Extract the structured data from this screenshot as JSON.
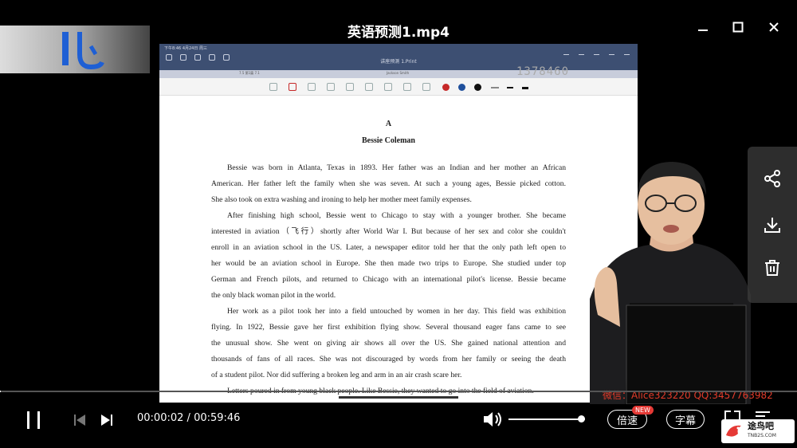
{
  "window": {
    "title": "英语预测1.mp4"
  },
  "screen_share": {
    "status_bar": "下午8:46  4月24日 周三",
    "doc_app_title": "讲座预测 1.Print",
    "tabs": [
      "7.5 第1篇 7.1",
      "Jackson Smith"
    ],
    "watermark_number": "1378460",
    "pen_colors": [
      "#c62828",
      "#1e4f9c",
      "#111111"
    ],
    "document": {
      "section": "A",
      "title": "Bessie Coleman",
      "paragraphs": [
        [
          "Bessie was born in Atlanta, Texas in 1893. Her father was an Indian and her mother an African",
          "American. Her father left the family when she was seven. At such a young ages, Bessie picked cotton.",
          "She also took on extra washing and ironing to help her mother meet family expenses."
        ],
        [
          "After finishing high school, Bessie went to Chicago to stay with a younger brother. She became",
          "interested in aviation（飞行）shortly after World War I. But because of her sex and color she couldn't",
          "enroll in an aviation school in the US. Later, a newspaper editor told her that the only path left open to",
          "her would be an aviation school in Europe. She then made two trips to Europe. She studied under top",
          "German and French pilots, and returned to Chicago with an international pilot's license. Bessie became",
          "the only black woman pilot in the world."
        ],
        [
          "Her work as a pilot took her into a field untouched by women in her day. This field was exhibition",
          "flying. In 1922, Bessie gave her first exhibition flying show. Several thousand eager fans came to see",
          "the unusual show. She went on giving air shows all over the US. She gained national attention and",
          "thousands of fans of all races. She was not discouraged by words from her family or seeing the death",
          "of a student pilot. Nor did suffering a broken leg and arm in an air crash scare her."
        ],
        [
          "Letters poured in from young black people. Like Bessie, they wanted to go into the field of aviation."
        ]
      ]
    }
  },
  "overlay": {
    "contact": "微信：Alice323220     QQ:3457763982"
  },
  "player": {
    "current_time": "00:00:02",
    "separator": "/",
    "total_time": "00:59:46",
    "progress_fraction": 0.001,
    "volume_fraction": 0.95,
    "speed_label": "倍速",
    "new_badge": "NEW",
    "subtitle_label": "字幕",
    "site_logo_text": "途鸟吧",
    "site_logo_sub": "TNB2S.COM"
  },
  "side_panel": {
    "icons": [
      "share-icon",
      "download-icon",
      "trash-icon"
    ]
  }
}
